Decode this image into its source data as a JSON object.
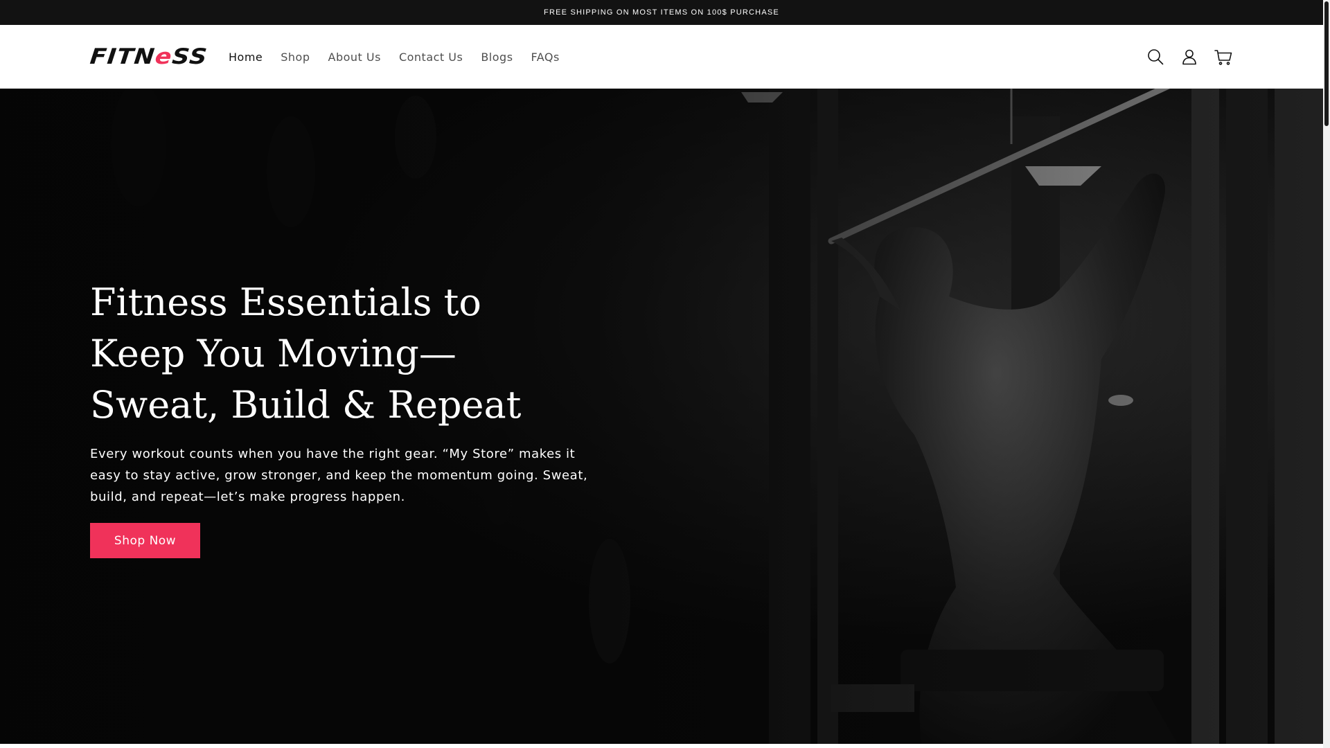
{
  "announcement": {
    "text": "FREE SHIPPING ON MOST ITEMS ON 100$ PURCHASE"
  },
  "header": {
    "logo": {
      "part1": "FITN",
      "part2": "e",
      "part3": "SS"
    },
    "nav": [
      {
        "label": "Home",
        "active": true
      },
      {
        "label": "Shop"
      },
      {
        "label": "About Us"
      },
      {
        "label": "Contact Us"
      },
      {
        "label": "Blogs"
      },
      {
        "label": "FAQs"
      }
    ],
    "icons": [
      "search-icon",
      "account-icon",
      "cart-icon"
    ]
  },
  "hero": {
    "title": "Fitness Essentials to Keep You Moving—Sweat, Build & Repeat",
    "subtitle": "Every workout counts when you have the right gear. “My Store” makes it easy to stay active, grow stronger, and keep the momentum going. Sweat, build, and repeat—let’s make progress happen.",
    "button_label": "Shop Now"
  },
  "colors": {
    "accent": "#f0325a",
    "announcement_bg": "#121212",
    "hero_bg": "#060606"
  }
}
